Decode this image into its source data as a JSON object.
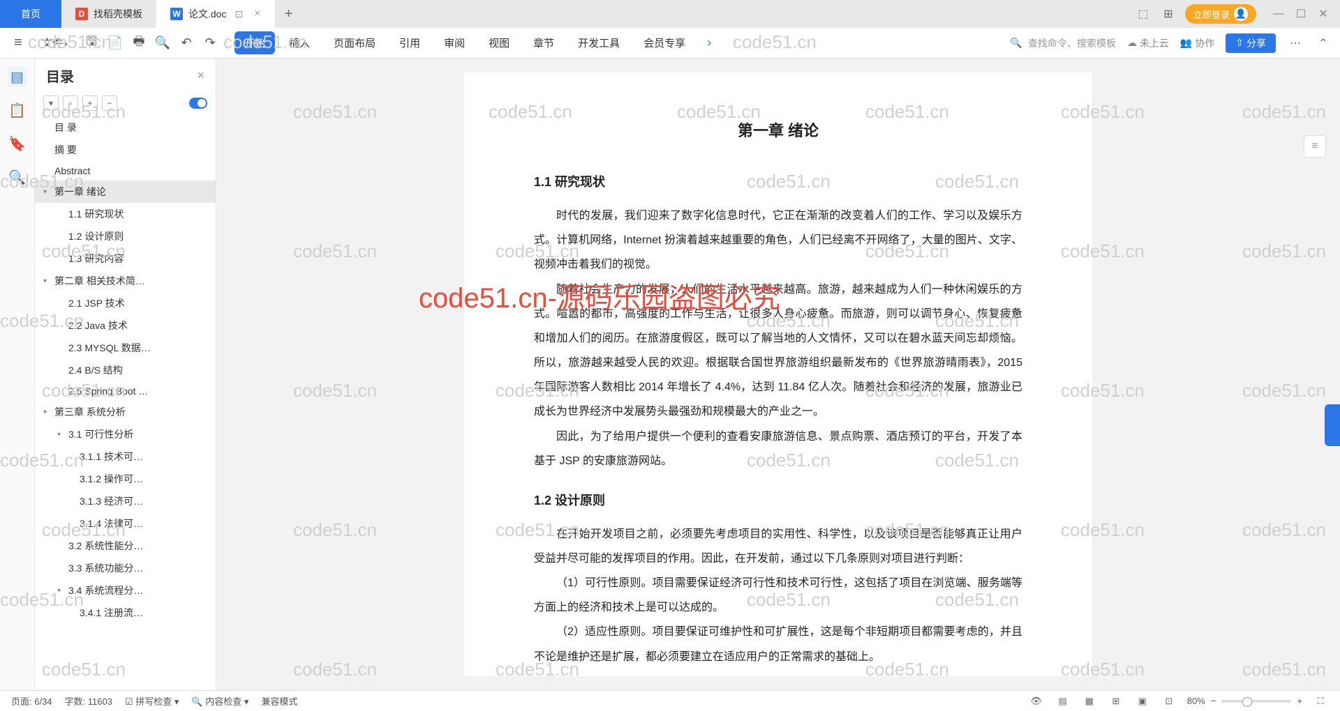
{
  "tabs": {
    "home": "首页",
    "template": "找稻壳模板",
    "doc": "论文.doc"
  },
  "login": "立即登录",
  "menu": {
    "file": "文件",
    "start": "开始",
    "insert": "插入",
    "layout": "页面布局",
    "reference": "引用",
    "review": "审阅",
    "view": "视图",
    "section": "章节",
    "devtools": "开发工具",
    "member": "会员专享",
    "search_placeholder": "查找命令、搜索模板",
    "cloud": "未上云",
    "coop": "协作",
    "share": "分享"
  },
  "outline": {
    "title": "目录",
    "items": [
      {
        "level": 0,
        "text": "目    录",
        "chev": ""
      },
      {
        "level": 0,
        "text": "摘  要",
        "chev": ""
      },
      {
        "level": 0,
        "text": "Abstract",
        "chev": ""
      },
      {
        "level": 1,
        "text": "第一章  绪论",
        "chev": "▾",
        "selected": true
      },
      {
        "level": 2,
        "text": "1.1 研究现状"
      },
      {
        "level": 2,
        "text": "1.2 设计原则"
      },
      {
        "level": 2,
        "text": "1.3 研究内容"
      },
      {
        "level": 1,
        "text": "第二章 相关技术简…",
        "chev": "▾"
      },
      {
        "level": 2,
        "text": "2.1 JSP 技术"
      },
      {
        "level": 2,
        "text": "2.2 Java 技术"
      },
      {
        "level": 2,
        "text": "2.3 MYSQL 数据…"
      },
      {
        "level": 2,
        "text": "2.4 B/S 结构"
      },
      {
        "level": 2,
        "text": "2.5 Spring Boot …"
      },
      {
        "level": 1,
        "text": "第三章  系统分析",
        "chev": "▾"
      },
      {
        "level": 2,
        "text": "3.1 可行性分析",
        "chev": "▾"
      },
      {
        "level": 3,
        "text": "3.1.1 技术可…"
      },
      {
        "level": 3,
        "text": "3.1.2 操作可…"
      },
      {
        "level": 3,
        "text": "3.1.3 经济可…"
      },
      {
        "level": 3,
        "text": "3.1.4 法律可…"
      },
      {
        "level": 2,
        "text": "3.2 系统性能分…"
      },
      {
        "level": 2,
        "text": "3.3 系统功能分…"
      },
      {
        "level": 2,
        "text": "3.4 系统流程分…",
        "chev": "▾"
      },
      {
        "level": 3,
        "text": "3.4.1 注册流…"
      }
    ]
  },
  "document": {
    "chapter_title": "第一章  绪论",
    "s1_title": "1.1  研究现状",
    "p1": "时代的发展，我们迎来了数字化信息时代，它正在渐渐的改变着人们的工作、学习以及娱乐方式。计算机网络，Internet 扮演着越来越重要的角色，人们已经离不开网络了，大量的图片、文字、视频冲击着我们的视觉。",
    "p2": "随着社会生产力的发展，人们的生活水平越来越高。旅游，越来越成为人们一种休闲娱乐的方式。喧嚣的都市，高强度的工作与生活，让很多人身心疲惫。而旅游，则可以调节身心、恢复疲惫和增加人们的阅历。在旅游度假区，既可以了解当地的人文情怀，又可以在碧水蓝天间忘却烦恼。所以，旅游越来越受人民的欢迎。根据联合国世界旅游组织最新发布的《世界旅游晴雨表》，2015 年国际游客人数相比 2014 年增长了 4.4%，达到 11.84 亿人次。随着社会和经济的发展，旅游业已成长为世界经济中发展势头最强劲和规模最大的产业之一。",
    "p3": "因此，为了给用户提供一个便利的查看安康旅游信息、景点购票、酒店预订的平台，开发了本基于 JSP 的安康旅游网站。",
    "s2_title": "1.2  设计原则",
    "p4": "在开始开发项目之前，必须要先考虑项目的实用性、科学性，以及该项目是否能够真正让用户受益并尽可能的发挥项目的作用。因此，在开发前，通过以下几条原则对项目进行判断：",
    "p5": "（1）可行性原则。项目需要保证经济可行性和技术可行性，这包括了项目在浏览端、服务端等方面上的经济和技术上是可以达成的。",
    "p6": "（2）适应性原则。项目要保证可维护性和可扩展性，这是每个非短期项目都需要考虑的，并且不论是维护还是扩展，都必须要建立在适应用户的正常需求的基础上。"
  },
  "status": {
    "page": "页面: 6/34",
    "words": "字数: 11603",
    "spell": "拼写检查",
    "content": "内容检查",
    "compat": "兼容模式",
    "zoom": "80%"
  },
  "watermark": "code51.cn",
  "watermark_red": "code51.cn-源码乐园盗图必究"
}
